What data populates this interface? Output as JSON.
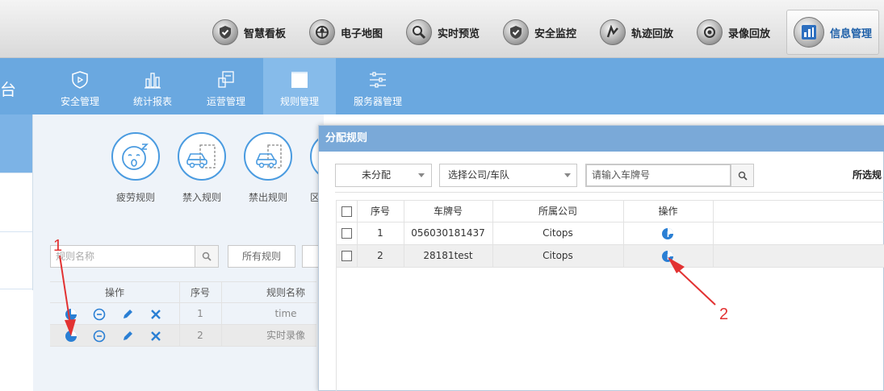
{
  "topnav": {
    "items": [
      {
        "label": "智慧看板",
        "icon": "shield-check-icon"
      },
      {
        "label": "电子地图",
        "icon": "map-globe-icon"
      },
      {
        "label": "实时预览",
        "icon": "magnifier-icon"
      },
      {
        "label": "安全监控",
        "icon": "shield-check-icon"
      },
      {
        "label": "轨迹回放",
        "icon": "route-icon"
      },
      {
        "label": "录像回放",
        "icon": "video-playback-icon"
      },
      {
        "label": "信息管理",
        "icon": "info-management-icon",
        "active": true
      }
    ]
  },
  "brand": {
    "partial_title": "台"
  },
  "modules": {
    "items": [
      {
        "label": "安全管理",
        "icon": "shield-play-icon"
      },
      {
        "label": "统计报表",
        "icon": "bar-chart-icon"
      },
      {
        "label": "运营管理",
        "icon": "operations-icon"
      },
      {
        "label": "规则管理",
        "icon": "rules-book-icon",
        "active": true
      },
      {
        "label": "服务器管理",
        "icon": "sliders-icon"
      }
    ]
  },
  "rule_cards": {
    "items": [
      {
        "label": "疲劳规则",
        "icon": "fatigue-face-icon"
      },
      {
        "label": "禁入规则",
        "icon": "car-enter-icon"
      },
      {
        "label": "禁出规则",
        "icon": "car-exit-icon"
      }
    ],
    "partial_fourth_label": "区"
  },
  "rule_search": {
    "placeholder": "规则名称",
    "all_rules": "所有规则"
  },
  "rule_table": {
    "headers": {
      "ops": "操作",
      "index": "序号",
      "name": "规则名称"
    },
    "rows": [
      {
        "index": "1",
        "name": "time"
      },
      {
        "index": "2",
        "name": "实时录像"
      }
    ]
  },
  "modal": {
    "title": "分配规则",
    "filter_status": "未分配",
    "filter_company": "选择公司/车队",
    "plate_placeholder": "请输入车牌号",
    "selected_label": "所选规",
    "table": {
      "headers": {
        "index": "序号",
        "plate": "车牌号",
        "company": "所属公司",
        "ops": "操作"
      },
      "rows": [
        {
          "index": "1",
          "plate": "056030181437",
          "company": "Citops"
        },
        {
          "index": "2",
          "plate": "28181test",
          "company": "Citops"
        }
      ]
    }
  },
  "annotations": {
    "one": "1",
    "two": "2"
  },
  "colors": {
    "primary_blue": "#6aa8e0",
    "annotation_red": "#e23232",
    "icon_blue": "#2a7fd4"
  }
}
